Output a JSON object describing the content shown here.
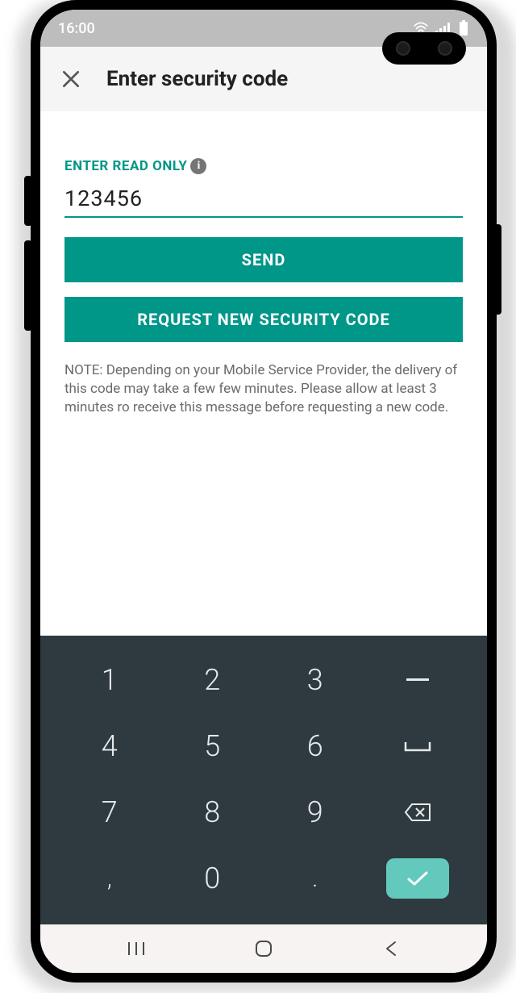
{
  "status": {
    "time": "16:00"
  },
  "appbar": {
    "title": "Enter security code"
  },
  "form": {
    "label": "ENTER READ ONLY",
    "code_value": "123456",
    "send_label": "SEND",
    "request_label": "REQUEST NEW SECURITY CODE",
    "note": "NOTE: Depending on your Mobile Service Provider, the delivery of this code may take a few few minutes. Please allow at least 3 minutes ro receive this message before requesting a new code."
  },
  "keyboard": {
    "rows": [
      [
        "1",
        "2",
        "3",
        "–"
      ],
      [
        "4",
        "5",
        "6",
        "␣"
      ],
      [
        "7",
        "8",
        "9",
        "⌫"
      ],
      [
        ",",
        "0",
        ".",
        "✓"
      ]
    ]
  }
}
